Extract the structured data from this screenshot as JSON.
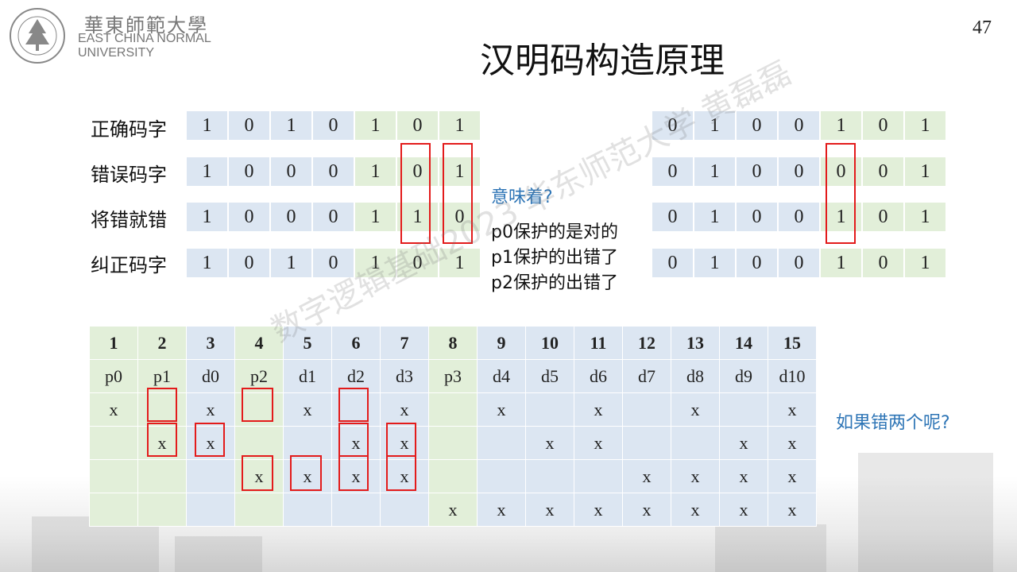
{
  "header": {
    "logo_cn": "華東師範大學",
    "logo_en_line1": "EAST CHINA NORMAL",
    "logo_en_line2": "UNIVERSITY",
    "page_number": "47",
    "title": "汉明码构造原理"
  },
  "left_rows": [
    {
      "label": "正确码字",
      "bits": [
        "1",
        "0",
        "1",
        "0",
        "1",
        "0",
        "1"
      ]
    },
    {
      "label": "错误码字",
      "bits": [
        "1",
        "0",
        "0",
        "0",
        "1",
        "0",
        "1"
      ]
    },
    {
      "label": "将错就错",
      "bits": [
        "1",
        "0",
        "0",
        "0",
        "1",
        "1",
        "0"
      ]
    },
    {
      "label": "纠正码字",
      "bits": [
        "1",
        "0",
        "1",
        "0",
        "1",
        "0",
        "1"
      ]
    }
  ],
  "right_rows": [
    [
      "0",
      "1",
      "0",
      "0",
      "1",
      "0",
      "1"
    ],
    [
      "0",
      "1",
      "0",
      "0",
      "0",
      "0",
      "1"
    ],
    [
      "0",
      "1",
      "0",
      "0",
      "1",
      "0",
      "1"
    ],
    [
      "0",
      "1",
      "0",
      "0",
      "1",
      "0",
      "1"
    ]
  ],
  "notes": {
    "question": "意味着?",
    "line1": "p0保护的是对的",
    "line2": "p1保护的出错了",
    "line3": "p2保护的出错了",
    "ask": "如果错两个呢?"
  },
  "hamming": {
    "positions": [
      "1",
      "2",
      "3",
      "4",
      "5",
      "6",
      "7",
      "8",
      "9",
      "10",
      "11",
      "12",
      "13",
      "14",
      "15"
    ],
    "names": [
      "p0",
      "p1",
      "d0",
      "p2",
      "d1",
      "d2",
      "d3",
      "p3",
      "d4",
      "d5",
      "d6",
      "d7",
      "d8",
      "d9",
      "d10"
    ],
    "rows": [
      [
        "x",
        "",
        "x",
        "",
        "x",
        "",
        "x",
        "",
        "x",
        "",
        "x",
        "",
        "x",
        "",
        "x"
      ],
      [
        "",
        "x",
        "x",
        "",
        "",
        "x",
        "x",
        "",
        "",
        "x",
        "x",
        "",
        "",
        "x",
        "x"
      ],
      [
        "",
        "",
        "",
        "x",
        "x",
        "x",
        "x",
        "",
        "",
        "",
        "",
        "x",
        "x",
        "x",
        "x"
      ],
      [
        "",
        "",
        "",
        "",
        "",
        "",
        "",
        "x",
        "x",
        "x",
        "x",
        "x",
        "x",
        "x",
        "x"
      ]
    ]
  },
  "watermark": "数字逻辑基础2023 华东师范大学 黄磊磊",
  "colors": {
    "blue_cell": "#dce6f2",
    "green_cell": "#e2efd9",
    "highlight": "#e31b1b",
    "accent_text": "#2e75b6"
  }
}
